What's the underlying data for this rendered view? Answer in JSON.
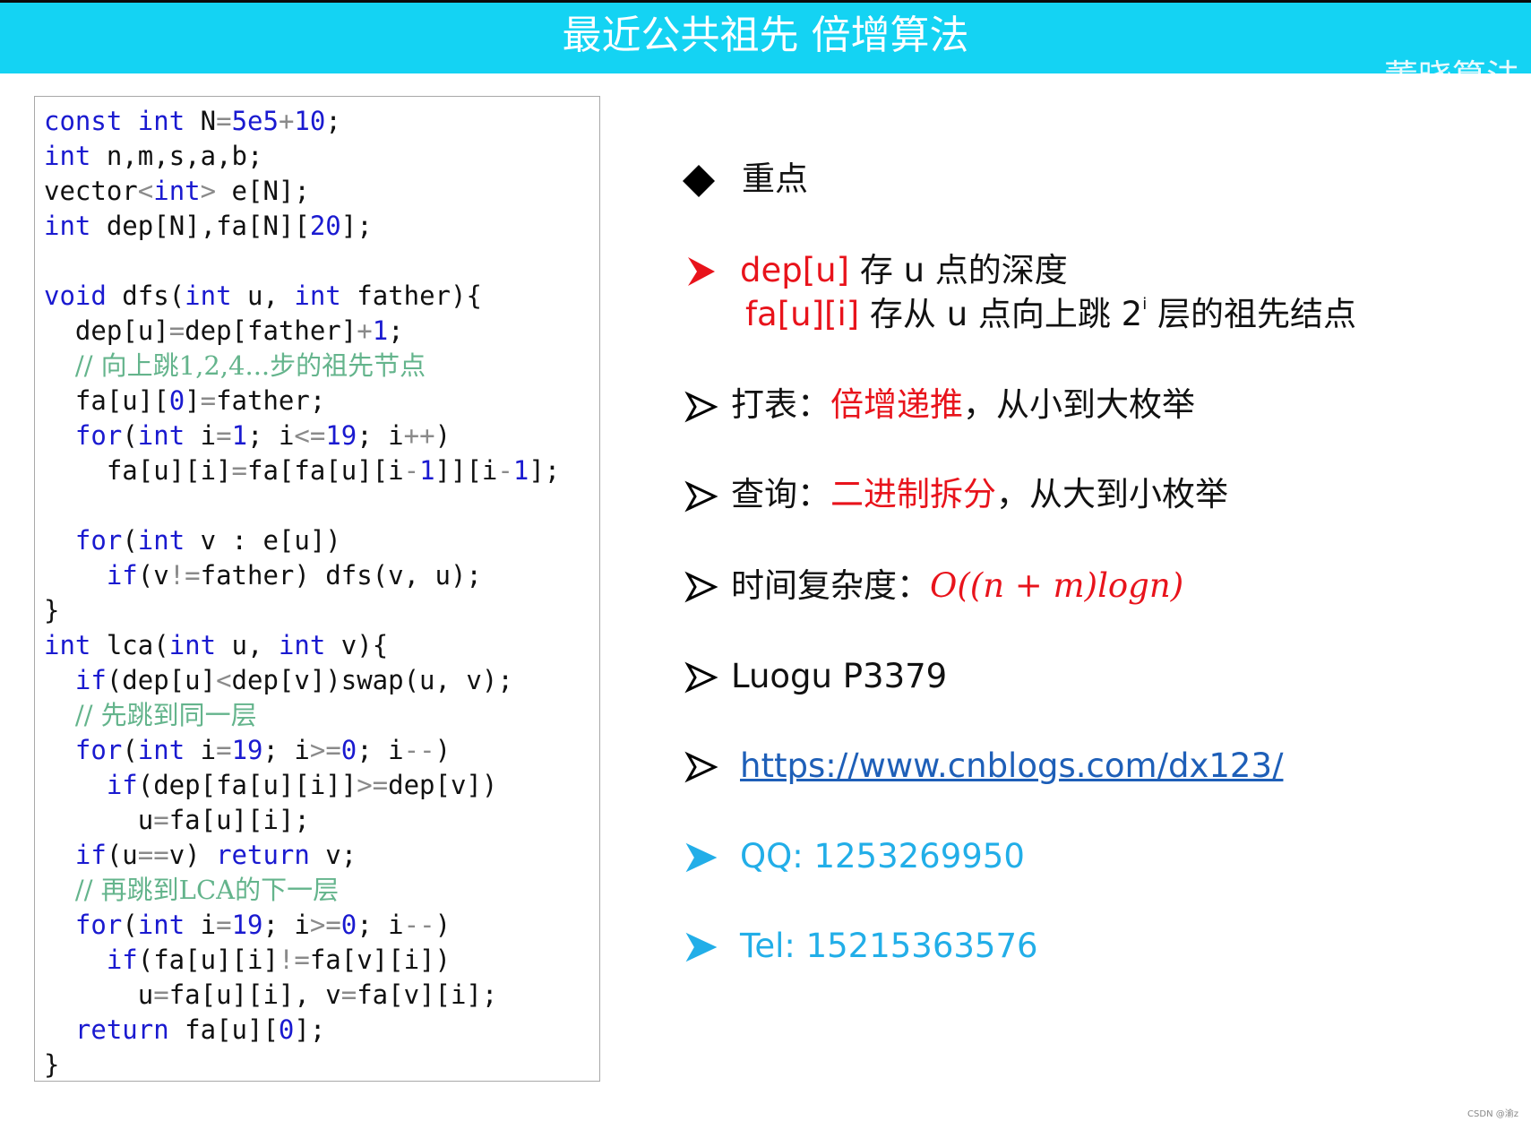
{
  "header": {
    "title": "最近公共祖先 倍增算法",
    "logo_text": "董晓算法"
  },
  "code": {
    "lines": [
      [
        {
          "t": "const",
          "c": "kw"
        },
        {
          "t": " "
        },
        {
          "t": "int",
          "c": "kw"
        },
        {
          "t": " N"
        },
        {
          "t": "=",
          "c": "op"
        },
        {
          "t": "5e5",
          "c": "num"
        },
        {
          "t": "+",
          "c": "op"
        },
        {
          "t": "10",
          "c": "num"
        },
        {
          "t": ";"
        }
      ],
      [
        {
          "t": "int",
          "c": "kw"
        },
        {
          "t": " n,m,s,a,b;"
        }
      ],
      [
        {
          "t": "vector"
        },
        {
          "t": "<",
          "c": "op"
        },
        {
          "t": "int",
          "c": "kw"
        },
        {
          "t": ">",
          "c": "op"
        },
        {
          "t": " e[N];"
        }
      ],
      [
        {
          "t": "int",
          "c": "kw"
        },
        {
          "t": " dep[N],fa[N]["
        },
        {
          "t": "20",
          "c": "num"
        },
        {
          "t": "];"
        }
      ],
      [],
      [
        {
          "t": "void",
          "c": "kw"
        },
        {
          "t": " dfs("
        },
        {
          "t": "int",
          "c": "kw"
        },
        {
          "t": " u, "
        },
        {
          "t": "int",
          "c": "kw"
        },
        {
          "t": " father){"
        }
      ],
      [
        {
          "t": "  dep[u]"
        },
        {
          "t": "=",
          "c": "op"
        },
        {
          "t": "dep[father]"
        },
        {
          "t": "+",
          "c": "op"
        },
        {
          "t": "1",
          "c": "num"
        },
        {
          "t": ";"
        }
      ],
      [
        {
          "t": "  "
        },
        {
          "t": "// 向上跳1,2,4...步的祖先节点",
          "c": "cmt"
        }
      ],
      [
        {
          "t": "  fa[u]["
        },
        {
          "t": "0",
          "c": "num"
        },
        {
          "t": "]"
        },
        {
          "t": "=",
          "c": "op"
        },
        {
          "t": "father;"
        }
      ],
      [
        {
          "t": "  "
        },
        {
          "t": "for",
          "c": "kw"
        },
        {
          "t": "("
        },
        {
          "t": "int",
          "c": "kw"
        },
        {
          "t": " i"
        },
        {
          "t": "=",
          "c": "op"
        },
        {
          "t": "1",
          "c": "num"
        },
        {
          "t": "; i"
        },
        {
          "t": "<=",
          "c": "op"
        },
        {
          "t": "19",
          "c": "num"
        },
        {
          "t": "; i"
        },
        {
          "t": "++",
          "c": "op"
        },
        {
          "t": ")"
        }
      ],
      [
        {
          "t": "    fa[u][i]"
        },
        {
          "t": "=",
          "c": "op"
        },
        {
          "t": "fa[fa[u][i"
        },
        {
          "t": "-",
          "c": "op"
        },
        {
          "t": "1",
          "c": "num"
        },
        {
          "t": "]][i"
        },
        {
          "t": "-",
          "c": "op"
        },
        {
          "t": "1",
          "c": "num"
        },
        {
          "t": "];"
        }
      ],
      [],
      [
        {
          "t": "  "
        },
        {
          "t": "for",
          "c": "kw"
        },
        {
          "t": "("
        },
        {
          "t": "int",
          "c": "kw"
        },
        {
          "t": " v : e[u])"
        }
      ],
      [
        {
          "t": "    "
        },
        {
          "t": "if",
          "c": "kw"
        },
        {
          "t": "(v"
        },
        {
          "t": "!=",
          "c": "op"
        },
        {
          "t": "father) dfs(v, u);"
        }
      ],
      [
        {
          "t": "}"
        }
      ],
      [
        {
          "t": "int",
          "c": "kw"
        },
        {
          "t": " lca("
        },
        {
          "t": "int",
          "c": "kw"
        },
        {
          "t": " u, "
        },
        {
          "t": "int",
          "c": "kw"
        },
        {
          "t": " v){"
        }
      ],
      [
        {
          "t": "  "
        },
        {
          "t": "if",
          "c": "kw"
        },
        {
          "t": "(dep[u]"
        },
        {
          "t": "<",
          "c": "op"
        },
        {
          "t": "dep[v])swap(u, v);"
        }
      ],
      [
        {
          "t": "  "
        },
        {
          "t": "// 先跳到同一层",
          "c": "cmt"
        }
      ],
      [
        {
          "t": "  "
        },
        {
          "t": "for",
          "c": "kw"
        },
        {
          "t": "("
        },
        {
          "t": "int",
          "c": "kw"
        },
        {
          "t": " i"
        },
        {
          "t": "=",
          "c": "op"
        },
        {
          "t": "19",
          "c": "num"
        },
        {
          "t": "; i"
        },
        {
          "t": ">=",
          "c": "op"
        },
        {
          "t": "0",
          "c": "num"
        },
        {
          "t": "; i"
        },
        {
          "t": "--",
          "c": "op"
        },
        {
          "t": ")"
        }
      ],
      [
        {
          "t": "    "
        },
        {
          "t": "if",
          "c": "kw"
        },
        {
          "t": "(dep[fa[u][i]]"
        },
        {
          "t": ">=",
          "c": "op"
        },
        {
          "t": "dep[v])"
        }
      ],
      [
        {
          "t": "      u"
        },
        {
          "t": "=",
          "c": "op"
        },
        {
          "t": "fa[u][i];"
        }
      ],
      [
        {
          "t": "  "
        },
        {
          "t": "if",
          "c": "kw"
        },
        {
          "t": "(u"
        },
        {
          "t": "==",
          "c": "op"
        },
        {
          "t": "v) "
        },
        {
          "t": "return",
          "c": "kw"
        },
        {
          "t": " v;"
        }
      ],
      [
        {
          "t": "  "
        },
        {
          "t": "// 再跳到LCA的下一层",
          "c": "cmt"
        }
      ],
      [
        {
          "t": "  "
        },
        {
          "t": "for",
          "c": "kw"
        },
        {
          "t": "("
        },
        {
          "t": "int",
          "c": "kw"
        },
        {
          "t": " i"
        },
        {
          "t": "=",
          "c": "op"
        },
        {
          "t": "19",
          "c": "num"
        },
        {
          "t": "; i"
        },
        {
          "t": ">=",
          "c": "op"
        },
        {
          "t": "0",
          "c": "num"
        },
        {
          "t": "; i"
        },
        {
          "t": "--",
          "c": "op"
        },
        {
          "t": ")"
        }
      ],
      [
        {
          "t": "    "
        },
        {
          "t": "if",
          "c": "kw"
        },
        {
          "t": "(fa[u][i]"
        },
        {
          "t": "!=",
          "c": "op"
        },
        {
          "t": "fa[v][i])"
        }
      ],
      [
        {
          "t": "      u"
        },
        {
          "t": "=",
          "c": "op"
        },
        {
          "t": "fa[u][i], v"
        },
        {
          "t": "=",
          "c": "op"
        },
        {
          "t": "fa[v][i];"
        }
      ],
      [
        {
          "t": "  "
        },
        {
          "t": "return",
          "c": "kw"
        },
        {
          "t": " fa[u]["
        },
        {
          "t": "0",
          "c": "num"
        },
        {
          "t": "];"
        }
      ],
      [
        {
          "t": "}"
        }
      ]
    ]
  },
  "notes": {
    "key_points": "重点",
    "dep_term": "dep[u]",
    "dep_desc": " 存 u 点的深度",
    "fa_term": "fa[u][i]",
    "fa_desc_pre": " 存从 u 点向上跳 2",
    "fa_sup": "i",
    "fa_desc_post": " 层的祖先结点",
    "table_label": "打表：",
    "table_red": "倍增递推",
    "table_rest": "，从小到大枚举",
    "query_label": "查询：",
    "query_red": "二进制拆分",
    "query_rest": "，从大到小枚举",
    "complexity_label": "时间复杂度：",
    "complexity_formula": "O((n + m)logn)",
    "luogu": "Luogu P3379",
    "blog_url": "https://www.cnblogs.com/dx123/",
    "qq": "QQ: 1253269950",
    "tel": "Tel: 15215363576"
  },
  "colors": {
    "header_bg": "#14d3f3",
    "keyword": "#1a1ad0",
    "comment": "#64b48c",
    "emphasis_red": "#e8131b",
    "contact_cyan": "#22aee8"
  },
  "icons": [
    "diamond-bullet-icon",
    "arrow-bullet-icon"
  ],
  "footer": {
    "watermark": "CSDN @渝z"
  }
}
